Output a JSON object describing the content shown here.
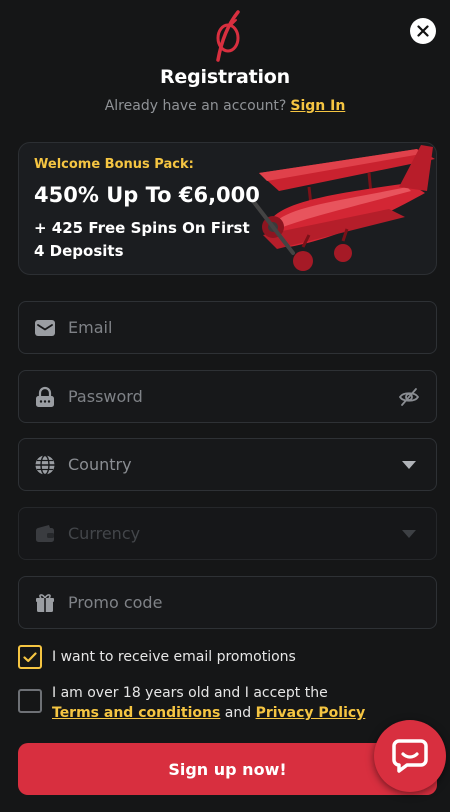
{
  "header": {
    "title": "Registration",
    "signin_prompt": "Already have an account?",
    "signin_link": "Sign In"
  },
  "bonus": {
    "eyebrow": "Welcome Bonus Pack:",
    "headline": "450% Up To €6,000",
    "subline": "+ 425 Free Spins On First 4 Deposits"
  },
  "form": {
    "email_placeholder": "Email",
    "password_placeholder": "Password",
    "country_placeholder": "Country",
    "currency_placeholder": "Currency",
    "promo_placeholder": "Promo code"
  },
  "consent": {
    "promotions_label": "I want to receive email promotions",
    "promotions_checked": true,
    "age_text": "I am over 18 years old and I accept the",
    "terms_link": "Terms and conditions",
    "and_text": "and",
    "privacy_link": "Privacy Policy",
    "age_checked": false
  },
  "actions": {
    "submit_label": "Sign up now!"
  },
  "colors": {
    "accent": "#f5c542",
    "brand": "#d82f3f",
    "background": "#151617"
  }
}
